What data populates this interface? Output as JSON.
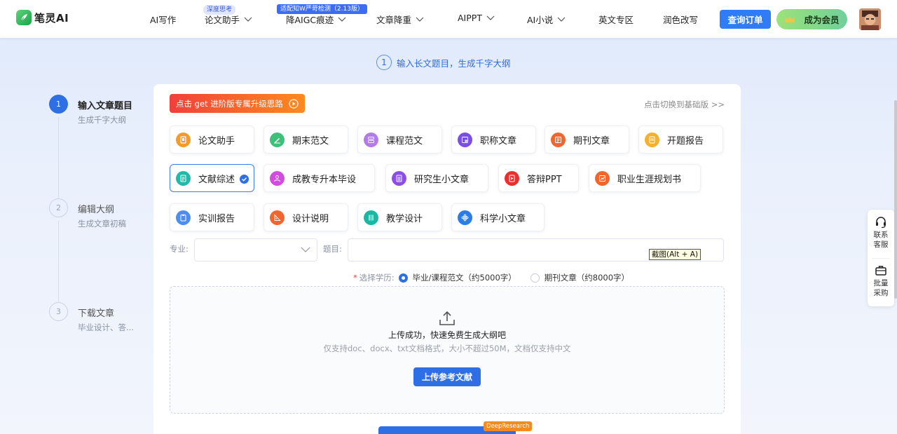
{
  "header": {
    "logo_text": "笔灵AI",
    "nav": [
      {
        "label": "AI写作"
      },
      {
        "label": "论文助手",
        "badge": "深度思考"
      },
      {
        "label": "降AIGC痕迹",
        "badge": "适配知W严苛检测（2.13版）"
      },
      {
        "label": "文章降重"
      },
      {
        "label": "AIPPT"
      },
      {
        "label": "AI小说"
      },
      {
        "label": "英文专区"
      },
      {
        "label": "润色改写"
      }
    ],
    "order_button": "查询订单",
    "vip_button": "成为会员"
  },
  "top_step": {
    "number": "1",
    "text": "输入长文题目，生成千字大纲"
  },
  "steps": [
    {
      "number": "1",
      "title": "输入文章题目",
      "subtitle": "生成千字大纲"
    },
    {
      "number": "2",
      "title": "编辑大纲",
      "subtitle": "生成文章初稿"
    },
    {
      "number": "3",
      "title": "下载文章",
      "subtitle": "毕业设计、答..."
    }
  ],
  "card": {
    "promo": "点击 get 进阶版专属升级思路",
    "switch_link": "点击切换到基础版 >>",
    "categories": [
      {
        "label": "论文助手",
        "color": "#f59b2c"
      },
      {
        "label": "期末范文",
        "color": "#3ec07a"
      },
      {
        "label": "课程范文",
        "color": "#b47ae8"
      },
      {
        "label": "职称文章",
        "color": "#7b4ee8"
      },
      {
        "label": "期刊文章",
        "color": "#f2662e"
      },
      {
        "label": "开题报告",
        "color": "#f5b02c"
      },
      {
        "label": "文献综述",
        "color": "#22b9a8",
        "selected": true
      },
      {
        "label": "成教专升本毕设",
        "color": "#d24ce0"
      },
      {
        "label": "研究生小文章",
        "color": "#8c4ee8"
      },
      {
        "label": "答辩PPT",
        "color": "#e8302e"
      },
      {
        "label": "职业生涯规划书",
        "color": "#f2662e"
      },
      {
        "label": "实训报告",
        "color": "#4c8ef0"
      },
      {
        "label": "设计说明",
        "color": "#f2662e"
      },
      {
        "label": "教学设计",
        "color": "#18b8a4"
      },
      {
        "label": "科学小文章",
        "color": "#2c7ce8"
      }
    ],
    "major_label": "专业:",
    "major_value": "",
    "title_label": "题目:",
    "title_value": "",
    "tooltip": "截图(Alt + A)",
    "edu": {
      "required_mark": "*",
      "label": "选择学历:",
      "options": [
        {
          "label": "毕业/课程范文（约5000字）",
          "selected": true
        },
        {
          "label": "期刊文章（约8000字）",
          "selected": false
        }
      ]
    },
    "upload": {
      "title": "上传成功，快速免费生成大纲吧",
      "subtitle": "仅支持doc、docx、txt文档格式，大小不超过50M，文档仅支持中文",
      "button": "上传参考文献"
    },
    "deep_tag": "DeepResearch"
  },
  "float_panel": {
    "service": "联系客服",
    "bulk": "批量采购"
  },
  "colors": {
    "primary": "#2f6fe6",
    "accent_orange": "#f28c20"
  }
}
